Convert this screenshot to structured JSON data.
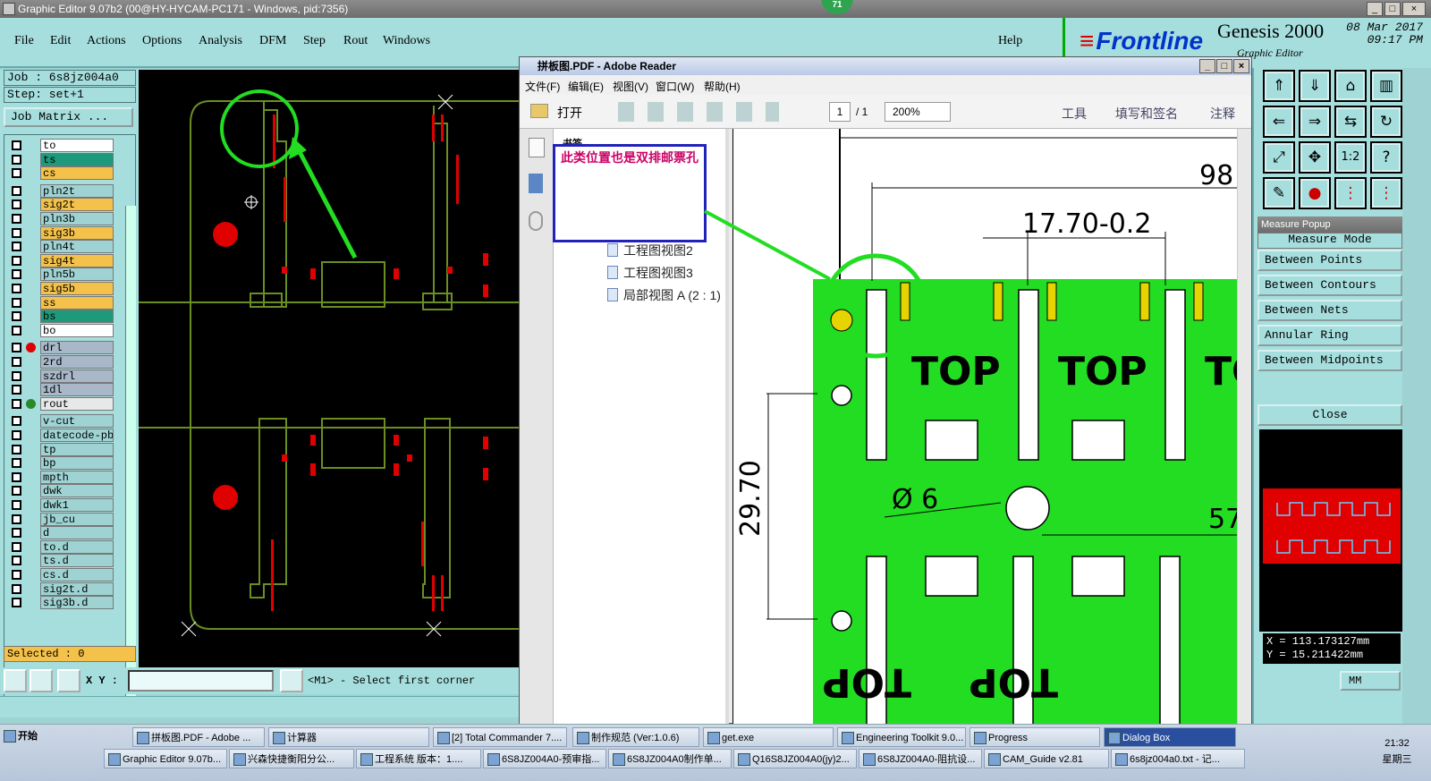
{
  "window": {
    "title": "Graphic Editor 9.07b2 (00@HY-HYCAM-PC171 - Windows, pid:7356)",
    "badge": "71"
  },
  "menu": {
    "items": [
      "File",
      "Edit",
      "Actions",
      "Options",
      "Analysis",
      "DFM",
      "Step",
      "Rout",
      "Windows"
    ],
    "help": "Help"
  },
  "brand": {
    "logo": "Frontline",
    "product": "Genesis 2000",
    "subtitle": "Graphic Editor",
    "date": "08 Mar 2017",
    "time": "09:17 PM"
  },
  "job": {
    "job": "Job : 6s8jz004a0",
    "step": "Step: set+1",
    "matrix_label": "Job Matrix ..."
  },
  "layers": [
    {
      "name": "to",
      "color": "#ffffff"
    },
    {
      "name": "ts",
      "color": "#1e9a7a"
    },
    {
      "name": "cs",
      "color": "#f4c24a"
    },
    {
      "name": "pln2t",
      "color": "#9fd3d3"
    },
    {
      "name": "sig2t",
      "color": "#f4c24a"
    },
    {
      "name": "pln3b",
      "color": "#9fd3d3"
    },
    {
      "name": "sig3b",
      "color": "#f4c24a"
    },
    {
      "name": "pln4t",
      "color": "#9fd3d3"
    },
    {
      "name": "sig4t",
      "color": "#f4c24a"
    },
    {
      "name": "pln5b",
      "color": "#9fd3d3"
    },
    {
      "name": "sig5b",
      "color": "#f4c24a"
    },
    {
      "name": "ss",
      "color": "#f4c24a"
    },
    {
      "name": "bs",
      "color": "#1e9a7a"
    },
    {
      "name": "bo",
      "color": "#ffffff"
    },
    {
      "name": "drl",
      "color": "#a8b8c8",
      "dot": "#e00000"
    },
    {
      "name": "2rd",
      "color": "#a8b8c8"
    },
    {
      "name": "szdrl",
      "color": "#a8b8c8"
    },
    {
      "name": "1dl",
      "color": "#a8b8c8"
    },
    {
      "name": "rout",
      "color": "#e8e8e8",
      "dot": "#2a8a2a"
    },
    {
      "name": "v-cut",
      "color": "#9fd3d3"
    },
    {
      "name": "datecode-pbe",
      "color": "#9fd3d3"
    },
    {
      "name": "tp",
      "color": "#9fd3d3"
    },
    {
      "name": "bp",
      "color": "#9fd3d3"
    },
    {
      "name": "mpth",
      "color": "#9fd3d3"
    },
    {
      "name": "dwk",
      "color": "#9fd3d3"
    },
    {
      "name": "dwk1",
      "color": "#9fd3d3"
    },
    {
      "name": "jb_cu",
      "color": "#9fd3d3"
    },
    {
      "name": "d",
      "color": "#9fd3d3"
    },
    {
      "name": "to.d",
      "color": "#9fd3d3"
    },
    {
      "name": "ts.d",
      "color": "#9fd3d3"
    },
    {
      "name": "cs.d",
      "color": "#9fd3d3"
    },
    {
      "name": "sig2t.d",
      "color": "#9fd3d3"
    },
    {
      "name": "sig3b.d",
      "color": "#9fd3d3"
    }
  ],
  "selected": "Selected : 0",
  "command": {
    "xy_label": "X Y :",
    "message": "<M1> - Select first corner"
  },
  "pdf": {
    "title": "拼板图.PDF - Adobe Reader",
    "menu": [
      "文件(F)",
      "编辑(E)",
      "视图(V)",
      "窗口(W)",
      "帮助(H)"
    ],
    "open": "打开",
    "page": "1",
    "page_total": "/ 1",
    "zoom": "200%",
    "tools": [
      "工具",
      "填写和签名",
      "注释"
    ],
    "bookmarks_header": "书签",
    "bookmarks": [
      "工程图视图2",
      "工程图视图3",
      "局部视图 A (2 : 1)"
    ],
    "annotation": "此类位置也是双排邮票孔",
    "dims": {
      "d98": "98",
      "d1770": "17.70-0.2",
      "d2970": "29.70",
      "dphi": "Ø 6",
      "d57": "57",
      "top": "TOP"
    }
  },
  "measure": {
    "title": "Measure Popup",
    "items": [
      "Measure Mode",
      "Between Points",
      "Between Contours",
      "Between Nets",
      "Annular Ring",
      "Between Midpoints"
    ],
    "close": "Close",
    "x": "X =  113.173127mm",
    "y": "Y =  15.211422mm",
    "unit": "MM"
  },
  "taskbar": {
    "start": "开始",
    "row1": [
      "拼板图.PDF - Adobe ...",
      "计算器",
      "[2] Total Commander 7....",
      "制作规范 (Ver:1.0.6)",
      "get.exe",
      "Engineering Toolkit 9.0...",
      "Progress",
      "Dialog Box"
    ],
    "row2": [
      "Graphic Editor 9.07b...",
      "兴森快捷衡阳分公...",
      "工程系统  版本：1....",
      "6S8JZ004A0-预审指...",
      "6S8JZ004A0制作单...",
      "Q16S8JZ004A0(jy)2...",
      "6S8JZ004A0-阻抗设...",
      "CAM_Guide v2.81",
      "6s8jz004a0.txt - 记..."
    ],
    "time": "21:32",
    "day": "星期三"
  }
}
